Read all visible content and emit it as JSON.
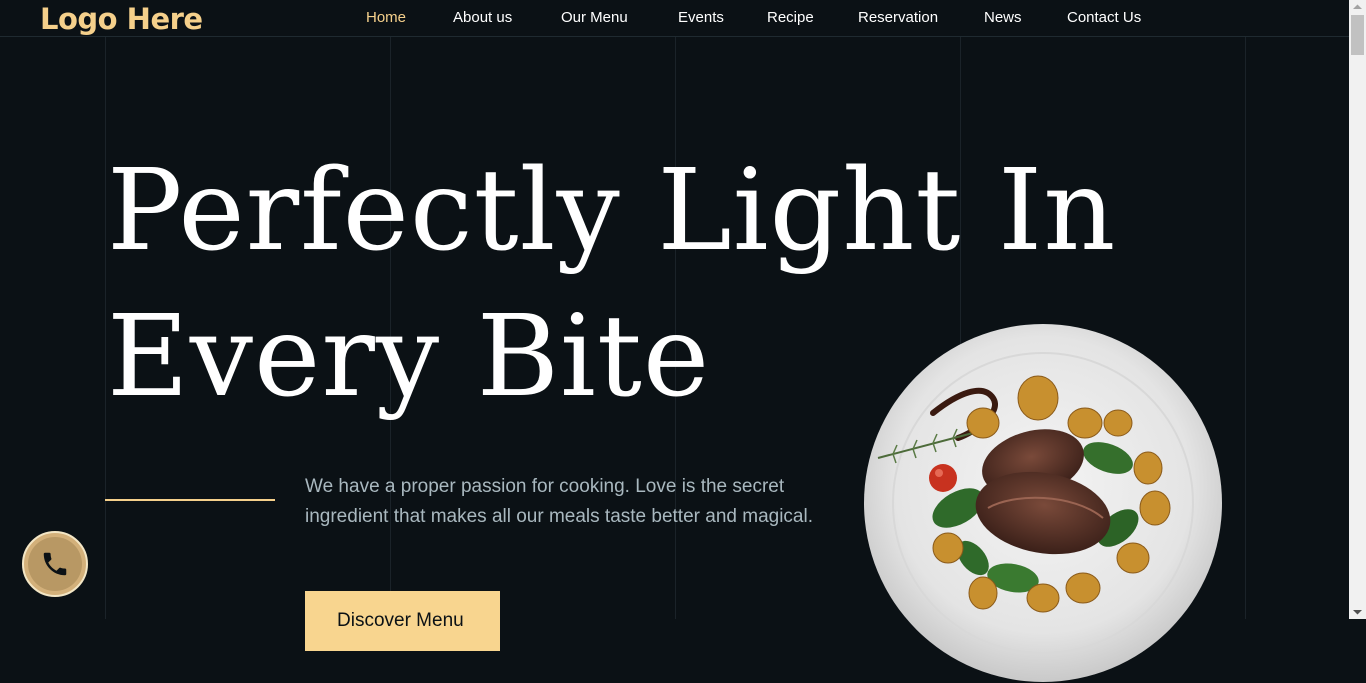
{
  "header": {
    "logo": "Logo Here",
    "nav": [
      {
        "label": "Home",
        "active": true
      },
      {
        "label": "About us"
      },
      {
        "label": "Our Menu"
      },
      {
        "label": "Events"
      },
      {
        "label": "Recipe"
      },
      {
        "label": "Reservation"
      },
      {
        "label": "News"
      },
      {
        "label": "Contact Us"
      }
    ]
  },
  "hero": {
    "title_line1": "Perfectly Light In",
    "title_line2": "Every Bite",
    "tagline": "We have a proper passion for cooking. Love is the secret ingredient that makes all our meals taste better and magical.",
    "cta_label": "Discover Menu"
  },
  "colors": {
    "background": "#0b1115",
    "accent": "#f5d08b",
    "text": "#ffffff",
    "muted": "#a9b8bf"
  },
  "icons": {
    "call": "phone-icon",
    "dish": "steak-plate-image"
  }
}
